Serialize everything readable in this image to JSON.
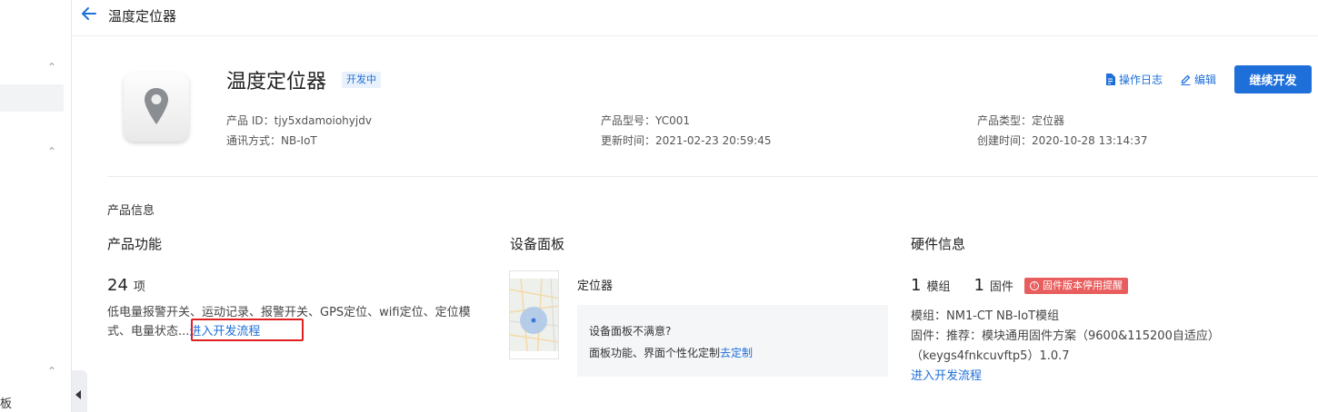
{
  "sidebar": {
    "bottom_text": "板"
  },
  "topbar": {
    "title": "温度定位器"
  },
  "product": {
    "name": "温度定位器",
    "status": "开发中",
    "id_label": "产品 ID：",
    "id_value": "tjy5xdamoiohyjdv",
    "comm_label": "通讯方式：",
    "comm_value": "NB-IoT",
    "model_label": "产品型号：",
    "model_value": "YC001",
    "updated_label": "更新时间：",
    "updated_value": "2021-02-23 20:59:45",
    "type_label": "产品类型：",
    "type_value": "定位器",
    "created_label": "创建时间：",
    "created_value": "2020-10-28 13:14:37"
  },
  "actions": {
    "log": "操作日志",
    "edit": "编辑",
    "continue": "继续开发"
  },
  "section": {
    "label": "产品信息"
  },
  "features": {
    "title": "产品功能",
    "count": "24",
    "unit": "项",
    "text": "低电量报警开关、运动记录、报警开关、GPS定位、wifi定位、定位模式、电量状态...",
    "link": "进入开发流程"
  },
  "panel": {
    "title": "设备面板",
    "name": "定位器",
    "question": "设备面板不满意?",
    "desc": "面板功能、界面个性化定制",
    "link": "去定制"
  },
  "hardware": {
    "title": "硬件信息",
    "module_count": "1",
    "module_unit": "模组",
    "firmware_count": "1",
    "firmware_unit": "固件",
    "warn": "固件版本停用提醒",
    "module_line": "模组：NM1-CT NB-IoT模组",
    "firmware_line": "固件：推荐：模块通用固件方案（9600&115200自适应）",
    "firmware_key": "（keygs4fnkcuvftp5）1.0.7",
    "link": "进入开发流程"
  },
  "colors": {
    "accent": "#1e6fd9",
    "warn": "#e85d5d",
    "highlight": "#e02020"
  }
}
